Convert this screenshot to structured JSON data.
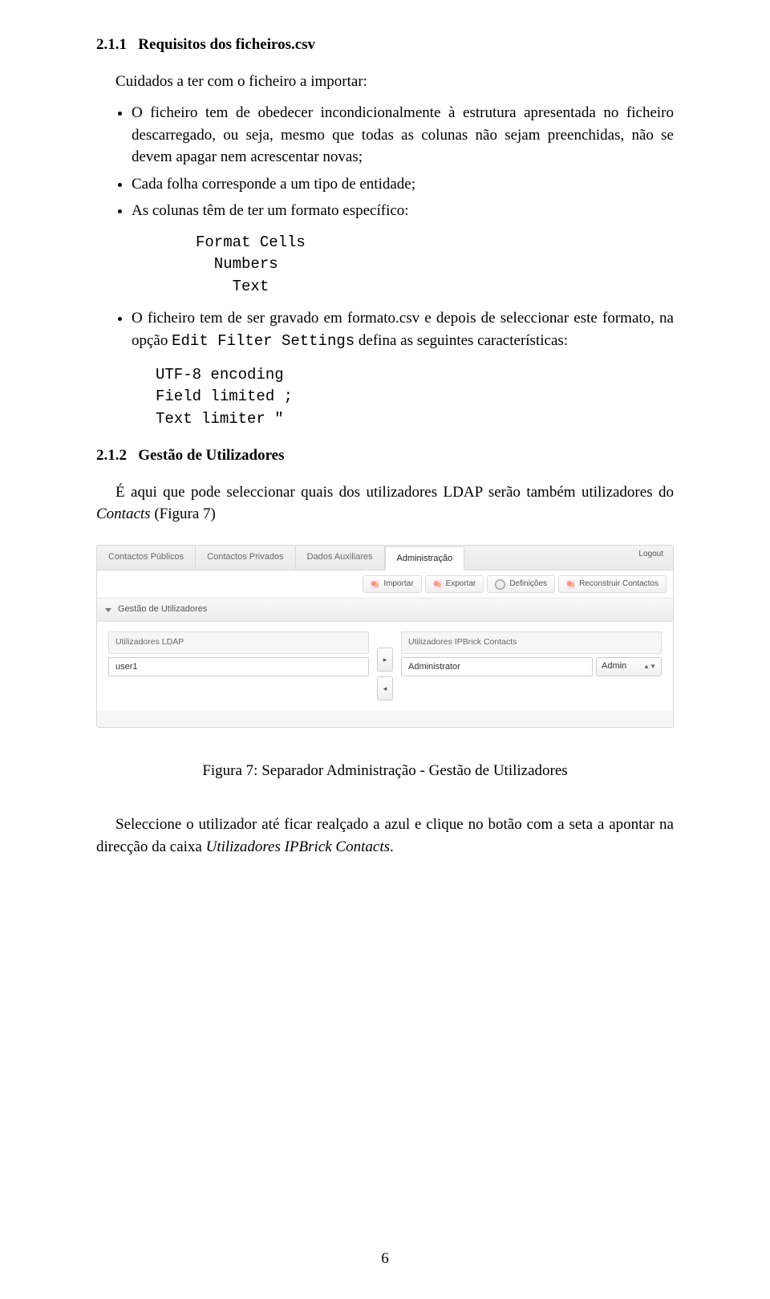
{
  "section_1": {
    "number": "2.1.1",
    "title": "Requisitos dos ficheiros.csv"
  },
  "intro": "Cuidados a ter com o ficheiro a importar:",
  "bullets_a": [
    "O ficheiro tem de obedecer incondicionalmente à estrutura apresentada no ficheiro descarregado, ou seja, mesmo que todas as colunas não sejam preenchidas, não se devem apagar nem acrescentar novas;",
    "Cada folha corresponde a um tipo de entidade;",
    "As colunas têm de ter um formato específico:"
  ],
  "code_block_1": "Format Cells\n  Numbers\n    Text",
  "bullets_b_pre": "O ficheiro tem de ser gravado em formato.csv e depois de seleccionar este formato, na opção ",
  "bullets_b_mono": "Edit Filter Settings",
  "bullets_b_post": " defina as seguintes características:",
  "code_block_2": "UTF-8 encoding\nField limited ;\nText limiter \"",
  "section_2": {
    "number": "2.1.2",
    "title": "Gestão de Utilizadores"
  },
  "para_2_pre": "É aqui que pode seleccionar quais dos utilizadores LDAP serão também utilizadores do ",
  "para_2_em": "Contacts",
  "para_2_post": " (Figura 7)",
  "app": {
    "tabs": [
      "Contactos Públicos",
      "Contactos Privados",
      "Dados Auxiliares",
      "Administração"
    ],
    "logout": "Logout",
    "toolbar": [
      "Importar",
      "Exportar",
      "Definições",
      "Reconstruir Contactos"
    ],
    "accordion": "Gestão de Utilizadores",
    "left_head": "Utilizadores LDAP",
    "left_value": "user1",
    "right_head": "Utilizadores IPBrick Contacts",
    "right_value": "Administrator",
    "role_select": "Admin"
  },
  "figure_caption": "Figura 7: Separador Administração - Gestão de Utilizadores",
  "para_final_pre": "Seleccione o utilizador até ficar realçado a azul e clique no botão com a seta a apontar na direcção da caixa ",
  "para_final_em": "Utilizadores IPBrick Contacts",
  "para_final_post": ".",
  "page_number": "6"
}
